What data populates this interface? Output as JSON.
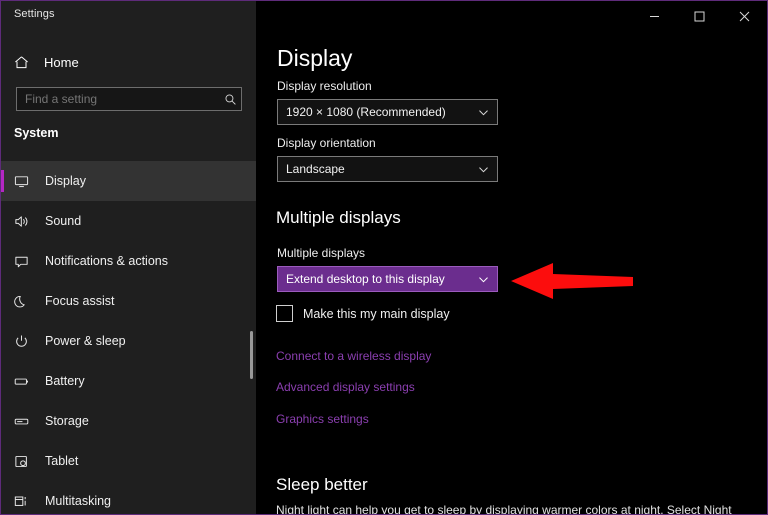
{
  "window": {
    "title": "Settings",
    "controls": [
      {
        "name": "minimize",
        "label": "–"
      },
      {
        "name": "maximize",
        "label": "□"
      },
      {
        "name": "close",
        "label": "✕"
      }
    ],
    "accent_color": "#b527c4",
    "border_color": "#5e2b7a",
    "sidebar_bg": "#1f1f1f",
    "content_bg": "#000000"
  },
  "sidebar": {
    "home_label": "Home",
    "search": {
      "placeholder": "Find a setting",
      "value": ""
    },
    "section_label": "System",
    "items": [
      {
        "label": "Display",
        "icon": "monitor-icon",
        "selected": true
      },
      {
        "label": "Sound",
        "icon": "speaker-icon",
        "selected": false
      },
      {
        "label": "Notifications & actions",
        "icon": "notification-icon",
        "selected": false
      },
      {
        "label": "Focus assist",
        "icon": "moon-icon",
        "selected": false
      },
      {
        "label": "Power & sleep",
        "icon": "power-icon",
        "selected": false
      },
      {
        "label": "Battery",
        "icon": "battery-icon",
        "selected": false
      },
      {
        "label": "Storage",
        "icon": "storage-icon",
        "selected": false
      },
      {
        "label": "Tablet",
        "icon": "tablet-icon",
        "selected": false
      },
      {
        "label": "Multitasking",
        "icon": "multitasking-icon",
        "selected": false
      }
    ]
  },
  "main": {
    "page_title": "Display",
    "display_resolution": {
      "label": "Display resolution",
      "value": "1920 × 1080 (Recommended)"
    },
    "display_orientation": {
      "label": "Display orientation",
      "value": "Landscape"
    },
    "multiple_displays_heading": "Multiple displays",
    "multiple_displays": {
      "label": "Multiple displays",
      "value": "Extend desktop to this display",
      "highlight_color": "#6b2d8e"
    },
    "main_display_checkbox": {
      "label": "Make this my main display",
      "checked": false
    },
    "links": [
      {
        "label": "Connect to a wireless display"
      },
      {
        "label": "Advanced display settings"
      },
      {
        "label": "Graphics settings"
      }
    ],
    "sleep_section": {
      "heading": "Sleep better",
      "body": "Night light can help you get to sleep by displaying warmer colors at night. Select Night"
    }
  },
  "annotation": {
    "arrow": {
      "name": "red-arrow-pointer",
      "color": "#ff0000",
      "direction": "left",
      "points_to": "Extend desktop to this display"
    }
  }
}
